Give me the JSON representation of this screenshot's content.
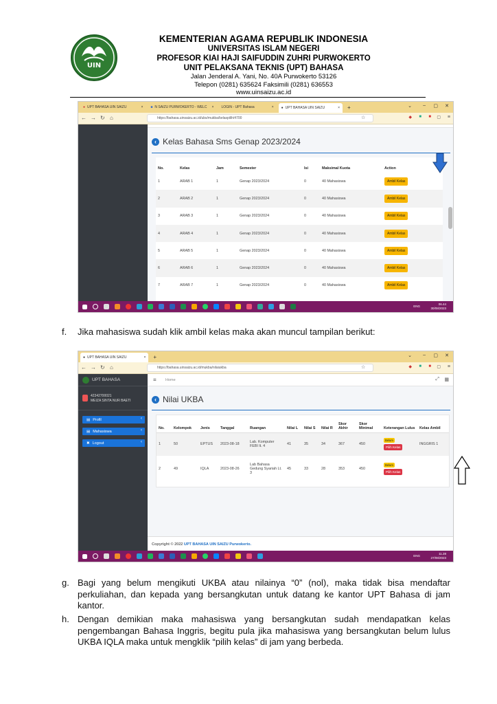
{
  "letterhead": {
    "line1": "KEMENTERIAN AGAMA REPUBLIK INDONESIA",
    "line2": "UNIVERSITAS ISLAM NEGERI",
    "line3": "PROFESOR KIAI HAJI SAIFUDDIN ZUHRI PURWOKERTO",
    "line4": "UNIT PELAKSANA TEKNIS (UPT) BAHASA",
    "address": "Jalan Jenderal A. Yani, No. 40A Purwokerto 53126",
    "phone": "Telepon (0281) 635624 Faksimili (0281) 636553",
    "web": "www.uinsaizu.ac.id",
    "logo_text": "UIN"
  },
  "shot1": {
    "tabs": [
      "UPT BAHASA UIN SAIZU",
      "N SAIZU PURWOKERTO - WELC",
      "LOGIN - UPT Bahasa",
      "UPT BAHASA UIN SAIZU"
    ],
    "url": "https://bahasa.uinsaizu.ac.id/ubs/mukba/kelaspilih/4700",
    "title": "Kelas Bahasa Sms Genap 2023/2024",
    "headers": [
      "No.",
      "Kelas",
      "Jam",
      "Semester",
      "Isi",
      "Maksimal Kuota",
      "Action"
    ],
    "rows": [
      [
        "1",
        "ARAB 1",
        "1",
        "Genap 2023/2024",
        "0",
        "40 Mahasiswa",
        "Ambil Kelas"
      ],
      [
        "2",
        "ARAB 2",
        "1",
        "Genap 2023/2024",
        "0",
        "40 Mahasiswa",
        "Ambil Kelas"
      ],
      [
        "3",
        "ARAB 3",
        "1",
        "Genap 2023/2024",
        "0",
        "40 Mahasiswa",
        "Ambil Kelas"
      ],
      [
        "4",
        "ARAB 4",
        "1",
        "Genap 2023/2024",
        "0",
        "40 Mahasiswa",
        "Ambil Kelas"
      ],
      [
        "5",
        "ARAB 5",
        "1",
        "Genap 2023/2024",
        "0",
        "40 Mahasiswa",
        "Ambil Kelas"
      ],
      [
        "6",
        "ARAB 6",
        "1",
        "Genap 2023/2024",
        "0",
        "40 Mahasiswa",
        "Ambil Kelas"
      ],
      [
        "7",
        "ARAB 7",
        "1",
        "Genap 2023/2024",
        "0",
        "40 Mahasiswa",
        "Ambil Kelas"
      ]
    ],
    "taskbar_time": "06.44",
    "taskbar_date": "30/08/2023",
    "taskbar_lang": "ENG"
  },
  "para_f": {
    "label": "f.",
    "text": "Jika mahasiswa sudah klik ambil kelas maka akan muncul tampilan berikut:"
  },
  "shot2": {
    "tab": "UPT BAHASA UIN SAIZU",
    "url": "https://bahasa.uinsaizu.ac.id/mukba/nilaiukba",
    "brand": "UPT BAHASA",
    "user_id": "42342700021",
    "user_name": "MEIZA SINTA NUR BAETI",
    "menu": [
      "Profil",
      "Mahasiswa",
      "Logout"
    ],
    "breadcrumb": "Home",
    "title": "Nilai UKBA",
    "headers": [
      "No.",
      "Kelompok",
      "Jenis",
      "Tanggal",
      "Ruangan",
      "Nilai L",
      "Nilai S",
      "Nilai R",
      "Skor Akhir",
      "Skor Minimal",
      "Keterangan Lulus",
      "Kelas Ambil"
    ],
    "rows": [
      {
        "no": "1",
        "kelompok": "50",
        "jenis": "EPTUS",
        "tanggal": "2023-08-18",
        "ruangan": "Lab. Komputer FEBI lt. 4",
        "l": "41",
        "s": "35",
        "r": "34",
        "akhir": "367",
        "minimal": "450",
        "badge": "Belum",
        "btn": "Pilih Kelas",
        "kelas": "INGGRIS 1"
      },
      {
        "no": "2",
        "kelompok": "49",
        "jenis": "IQLA",
        "tanggal": "2023-08-26",
        "ruangan": "Lab Bahasa Gedung Syariah Lt. 3",
        "l": "45",
        "s": "33",
        "r": "28",
        "akhir": "353",
        "minimal": "450",
        "badge": "Belum",
        "btn": "Pilih Kelas",
        "kelas": ""
      }
    ],
    "footer_prefix": "Copyright © 2022 ",
    "footer_link": "UPT BAHASA UIN SAIZU Purwokerto.",
    "taskbar_time": "11.28",
    "taskbar_date": "27/08/2023",
    "taskbar_lang": "ENG"
  },
  "para_g": {
    "label": "g.",
    "text": "Bagi yang belum mengikuti UKBA atau nilainya “0” (nol), maka tidak bisa mendaftar perkuliahan, dan kepada yang bersangkutan untuk datang ke kantor UPT Bahasa di jam kantor."
  },
  "para_h": {
    "label": "h.",
    "text": "Dengan demikian maka mahasiswa yang bersangkutan sudah mendapatkan kelas pengembangan Bahasa Inggris, begitu pula jika mahasiswa yang bersangkutan belum lulus UKBA IQLA maka untuk mengklik “pilih kelas” di jam yang berbeda."
  },
  "colors": {
    "accent": "#1f6fc4",
    "taskbar": "#7b1a63",
    "tabbar": "#f0d68c",
    "button": "#f7b500",
    "danger": "#dc3545"
  }
}
